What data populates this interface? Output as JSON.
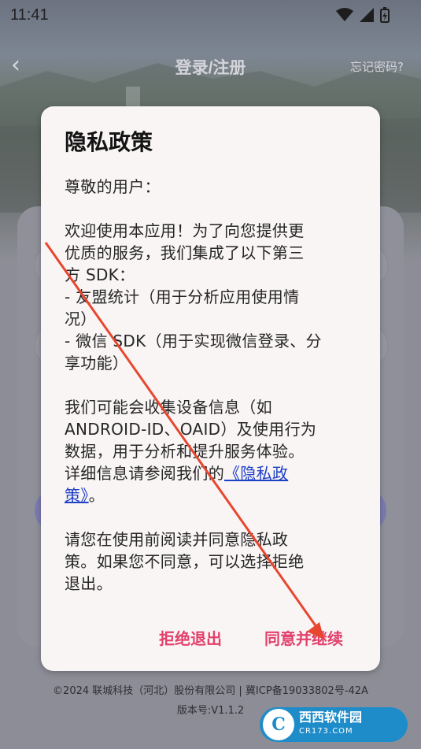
{
  "statusbar": {
    "time": "11:41"
  },
  "titlebar": {
    "title": "登录/注册",
    "back_icon": "‹",
    "forgot": "忘记密码?"
  },
  "dialog": {
    "title": "隐私政策",
    "greeting": "尊敬的用户：",
    "p1_lines": [
      "欢迎使用本应用！为了向您提供更",
      "优质的服务，我们集成了以下第三",
      "方 SDK：",
      "- 友盟统计（用于分析应用使用情",
      "况）",
      "- 微信 SDK（用于实现微信登录、分",
      "享功能）"
    ],
    "p2_lines": [
      "我们可能会收集设备信息（如",
      "ANDROID-ID、OAID）及使用行为",
      "数据，用于分析和提升服务体验。"
    ],
    "p2_pre_link": "详细信息请参阅我们的",
    "link_line1": "《隐私政",
    "link_line2": "策》",
    "p2_tail": "。",
    "p3_lines": [
      "请您在使用前阅读并同意隐私政",
      "策。如果您不同意，可以选择拒绝",
      "退出。"
    ],
    "reject_label": "拒绝退出",
    "agree_label": "同意并继续"
  },
  "footer": {
    "copyright": "©2024 联城科技（河北）股份有限公司 | 冀ICP备19033802号-42A",
    "version": "版本号:V1.1.2"
  },
  "watermark": {
    "logo": "C",
    "name": "西西软件园",
    "domain": "CR173.COM"
  },
  "colors": {
    "accent": "#e3406b",
    "link": "#1f3fc7",
    "arrow": "#e8472f"
  }
}
